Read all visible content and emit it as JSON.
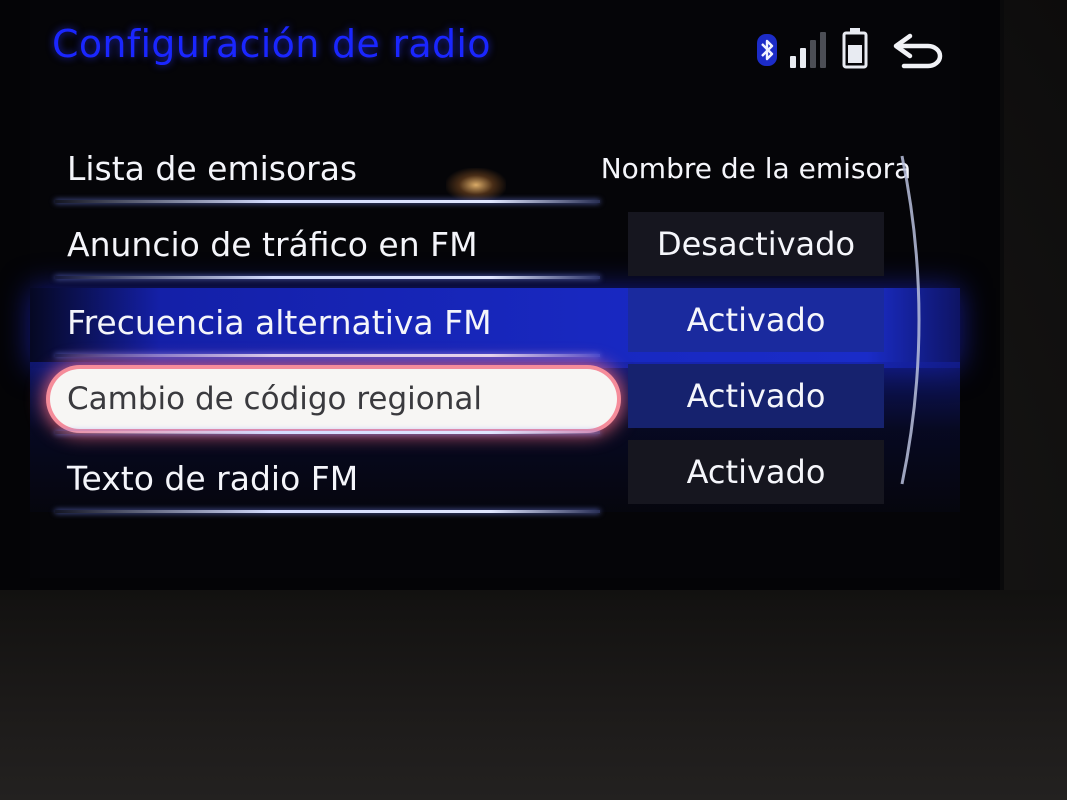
{
  "header": {
    "title": "Configuración de radio",
    "icons": {
      "bluetooth": "bluetooth-icon",
      "signal": "signal-strength-icon",
      "battery": "battery-icon",
      "back": "back-icon"
    },
    "signal_level": 0.5
  },
  "settings": [
    {
      "label": "Lista de emisoras",
      "value": "Nombre de la emisora"
    },
    {
      "label": "Anuncio de tráfico en FM",
      "value": "Desactivado"
    },
    {
      "label": "Frecuencia alternativa FM",
      "value": "Activado"
    },
    {
      "label": "Cambio de código regional",
      "value": "Activado"
    },
    {
      "label": "Texto de radio FM",
      "value": "Activado"
    }
  ],
  "colors": {
    "title": "#1a26ff",
    "highlight_band": "#1828c0",
    "focus_ring": "#f58c9a"
  }
}
